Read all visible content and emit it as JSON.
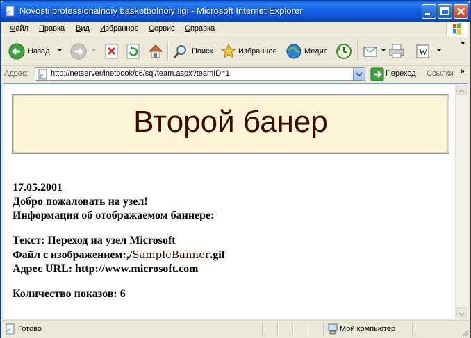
{
  "window": {
    "title": "Novosti professionalnoiy basketbolnoiy ligi - Microsoft Internet Explorer"
  },
  "menu": {
    "items": [
      {
        "u": "Ф",
        "rest": "айл"
      },
      {
        "u": "П",
        "rest": "равка"
      },
      {
        "u": "В",
        "rest": "ид"
      },
      {
        "u": "И",
        "rest": "збранное"
      },
      {
        "u": "С",
        "rest": "ервис"
      },
      {
        "u": "С",
        "rest": "правка"
      }
    ]
  },
  "toolbar": {
    "back_label": "Назад",
    "search_label": "Поиск",
    "favorites_label": "Избранное",
    "media_label": "Медиа"
  },
  "address": {
    "label": "Адрес:",
    "url": "http://netserver/inetbook/c6/sql/team.aspx?teamID=1",
    "go_label": "Переход",
    "links_label": "Ссылки"
  },
  "page": {
    "banner_text": "Второй банер",
    "date": "17.05.2001",
    "welcome": "Добро пожаловать на узел!",
    "info_heading": "Информация об отображаемом баннере:",
    "text_line": "Текст: Переход на узел Microsoft",
    "file_prefix": "Файл с изображением:,/",
    "file_name": "SampleBanner",
    "file_ext": ".gif",
    "url_line": "Адрес URL: http://www.microsoft.com",
    "views_line": "Количество показов: 6"
  },
  "status": {
    "text": "Готово",
    "zone": "Мой компьютер"
  },
  "colors": {
    "title_bar": "#0A5FDB",
    "chrome": "#ECE9D8",
    "banner_bg": "#FDF3D5",
    "banner_text": "#3A0A00"
  }
}
